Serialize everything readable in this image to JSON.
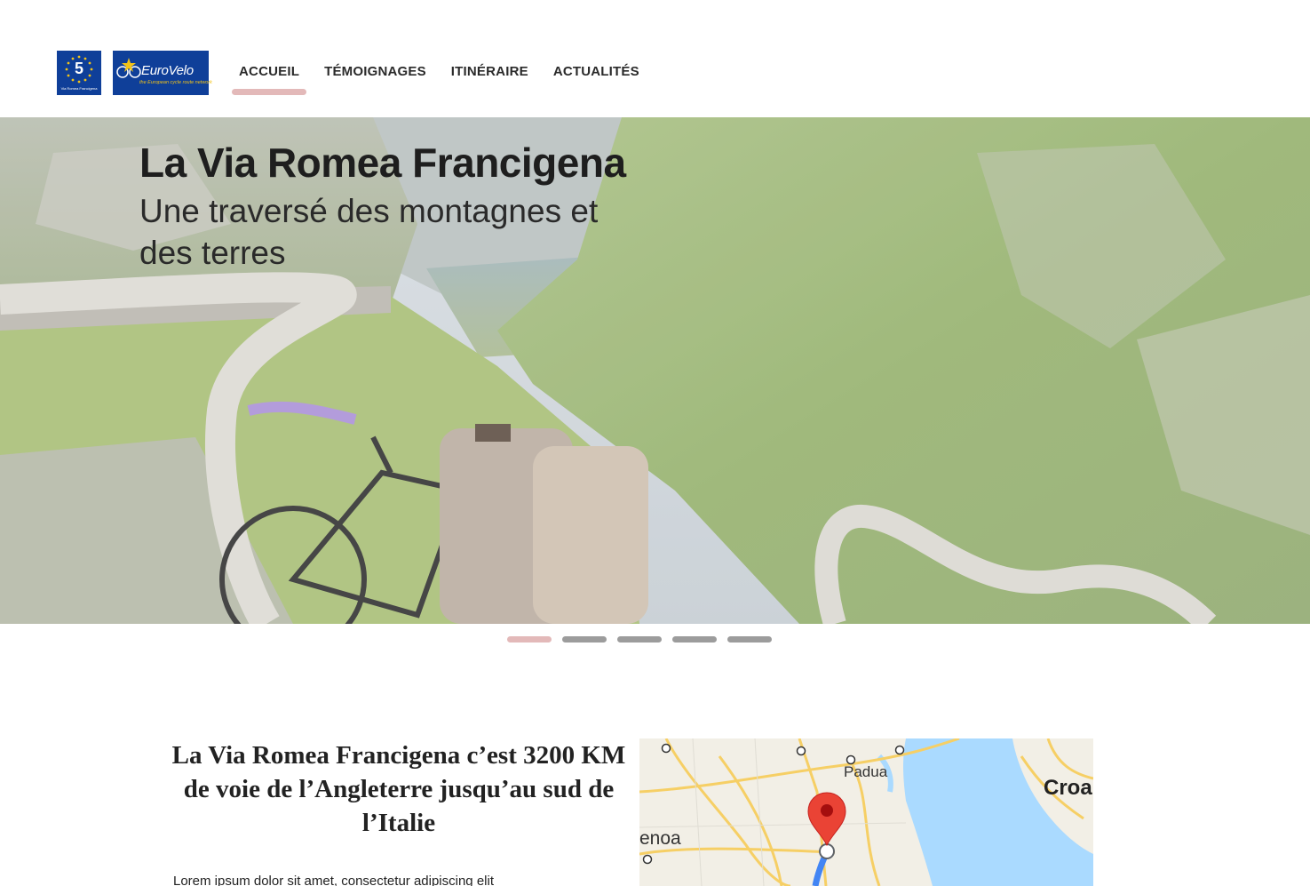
{
  "header": {
    "logo_v5": {
      "number": "5",
      "caption": "Via Romea Francigena"
    },
    "logo_eurovelo": {
      "name": "EuroVelo",
      "tagline": "the European cycle route network"
    },
    "nav": [
      {
        "label": "ACCUEIL",
        "active": true
      },
      {
        "label": "TÉMOIGNAGES",
        "active": false
      },
      {
        "label": "ITINÉRAIRE",
        "active": false
      },
      {
        "label": "ACTUALITÉS",
        "active": false
      }
    ]
  },
  "hero": {
    "title": "La Via Romea Francigena",
    "subtitle": "Une traversé des montagnes et des terres",
    "slide_count": 5,
    "active_slide": 1
  },
  "intro": {
    "headline": "La Via Romea Francigena c’est 3200 KM de voie de l’Angleterre jusqu’au sud de l’Italie",
    "body": "Lorem ipsum dolor sit amet, consectetur adipiscing elit"
  },
  "map": {
    "labels": {
      "padua": "Padua",
      "croatia": "Croa",
      "genoa": "enoa"
    },
    "marker": "location-pin"
  },
  "colors": {
    "accent": "#e3b9b9",
    "dot_inactive": "#9c9c9c",
    "logo_blue": "#0f3f99",
    "logo_yellow": "#f2c318",
    "map_water": "#aadaff",
    "map_land": "#f2efe6",
    "map_road": "#f6cf65",
    "marker_red": "#ea4335",
    "route_blue": "#4285f4"
  }
}
